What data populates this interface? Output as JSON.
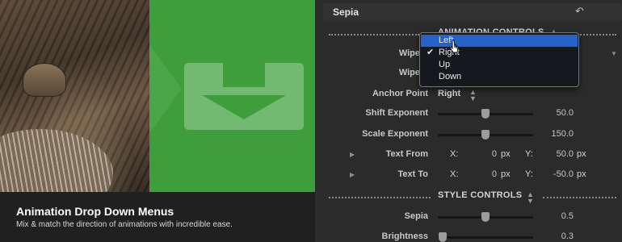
{
  "caption": {
    "title": "Animation Drop Down Menus",
    "subtitle": "Mix & match the direction of animations with incredible ease."
  },
  "inspector": {
    "header": "Sepia",
    "reset_icon": "undo-arrow-icon",
    "animation_section": "ANIMATION CONTROLS",
    "style_section": "STYLE CONTROLS",
    "wipe_in_label": "Wipe",
    "wipe_out_label": "Wipe",
    "anchor_point_label": "Anchor Point",
    "anchor_point_value": "Right",
    "shift_exponent": {
      "label": "Shift Exponent",
      "value": "50.0",
      "level": 0.5
    },
    "scale_exponent": {
      "label": "Scale Exponent",
      "value": "150.0",
      "level": 0.5
    },
    "text_from": {
      "label": "Text From",
      "x_label": "X:",
      "x": "0",
      "x_unit": "px",
      "y_label": "Y:",
      "y": "50.0",
      "y_unit": "px"
    },
    "text_to": {
      "label": "Text To",
      "x_label": "X:",
      "x": "0",
      "x_unit": "px",
      "y_label": "Y:",
      "y": "-50.0",
      "y_unit": "px"
    },
    "sepia": {
      "label": "Sepia",
      "value": "0.5",
      "level": 0.5
    },
    "brightness": {
      "label": "Brightness",
      "value": "0.3",
      "level": 0.05
    }
  },
  "dropdown": {
    "options": [
      "Left",
      "Right",
      "Up",
      "Down"
    ],
    "highlighted": "Left",
    "checked": "Right",
    "check_mark": "✔"
  },
  "colors": {
    "highlight": "#2763c7",
    "green_panel": "#3f9e3c"
  }
}
